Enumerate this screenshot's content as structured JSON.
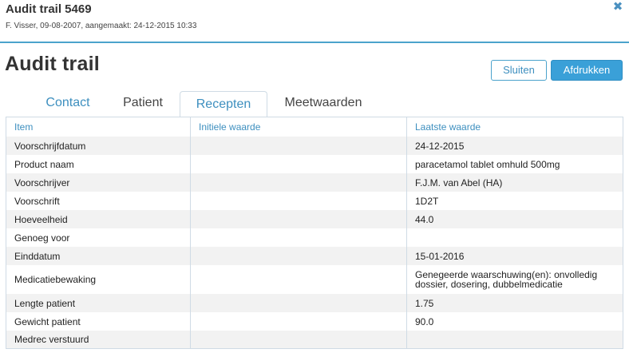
{
  "header": {
    "title": "Audit trail 5469",
    "subtitle": "F. Visser, 09-08-2007, aangemaakt: 24-12-2015 10:33",
    "close_glyph": "✖"
  },
  "page": {
    "title": "Audit trail"
  },
  "actions": {
    "close_label": "Sluiten",
    "print_label": "Afdrukken"
  },
  "tabs": [
    {
      "label": "Contact"
    },
    {
      "label": "Patient"
    },
    {
      "label": "Recepten",
      "active": true
    },
    {
      "label": "Meetwaarden"
    }
  ],
  "table": {
    "headers": [
      "Item",
      "Initiele waarde",
      "Laatste waarde"
    ],
    "rows": [
      {
        "item": "Voorschrijfdatum",
        "initial": "",
        "latest": "24-12-2015"
      },
      {
        "item": "Product naam",
        "initial": "",
        "latest": "paracetamol tablet omhuld 500mg"
      },
      {
        "item": "Voorschrijver",
        "initial": "",
        "latest": "F.J.M. van Abel (HA)"
      },
      {
        "item": "Voorschrift",
        "initial": "",
        "latest": "1D2T"
      },
      {
        "item": "Hoeveelheid",
        "initial": "",
        "latest": "44.0"
      },
      {
        "item": "Genoeg voor",
        "initial": "",
        "latest": ""
      },
      {
        "item": "Einddatum",
        "initial": "",
        "latest": "15-01-2016"
      },
      {
        "item": "Medicatiebewaking",
        "initial": "",
        "latest": "Genegeerde waarschuwing(en): onvolledig dossier, dosering, dubbelmedicatie"
      },
      {
        "item": "Lengte patient",
        "initial": "",
        "latest": "1.75"
      },
      {
        "item": "Gewicht patient",
        "initial": "",
        "latest": "90.0"
      },
      {
        "item": "Medrec verstuurd",
        "initial": "",
        "latest": ""
      }
    ]
  },
  "colors": {
    "accent": "#3d8fbf",
    "primary_button": "#3aa0d8",
    "border": "#cfdbe5",
    "stripe": "#f2f2f2"
  }
}
